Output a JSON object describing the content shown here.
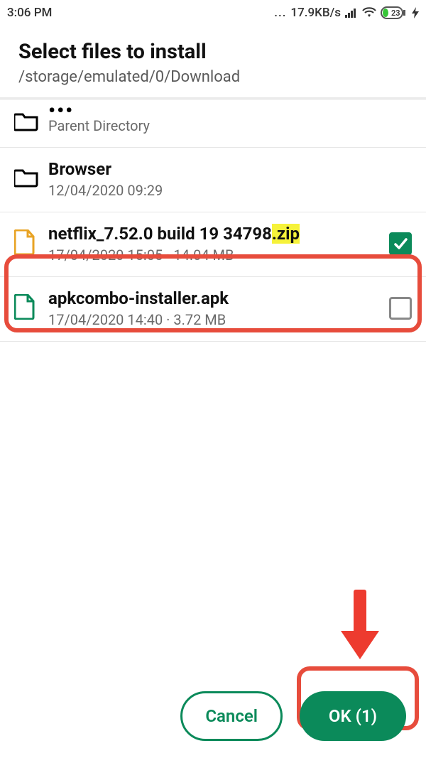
{
  "statusbar": {
    "time": "3:06 PM",
    "speed": "17.9KB/s",
    "battery": "23"
  },
  "header": {
    "title": "Select files to install",
    "path": "/storage/emulated/0/Download"
  },
  "rows": {
    "parent": {
      "dots": "•••",
      "label": "Parent Directory"
    },
    "browser": {
      "name": "Browser",
      "meta": "12/04/2020 09:29"
    },
    "netflix": {
      "name_prefix": "netflix_7.52.0 build 19 34798",
      "name_ext": ".zip",
      "meta": "17/04/2020 15:05 · 14.04 MB",
      "selected": true
    },
    "apkcombo": {
      "name": "apkcombo-installer.apk",
      "meta": "17/04/2020 14:40 · 3.72 MB",
      "selected": false
    }
  },
  "footer": {
    "cancel": "Cancel",
    "ok": "OK (1)"
  }
}
